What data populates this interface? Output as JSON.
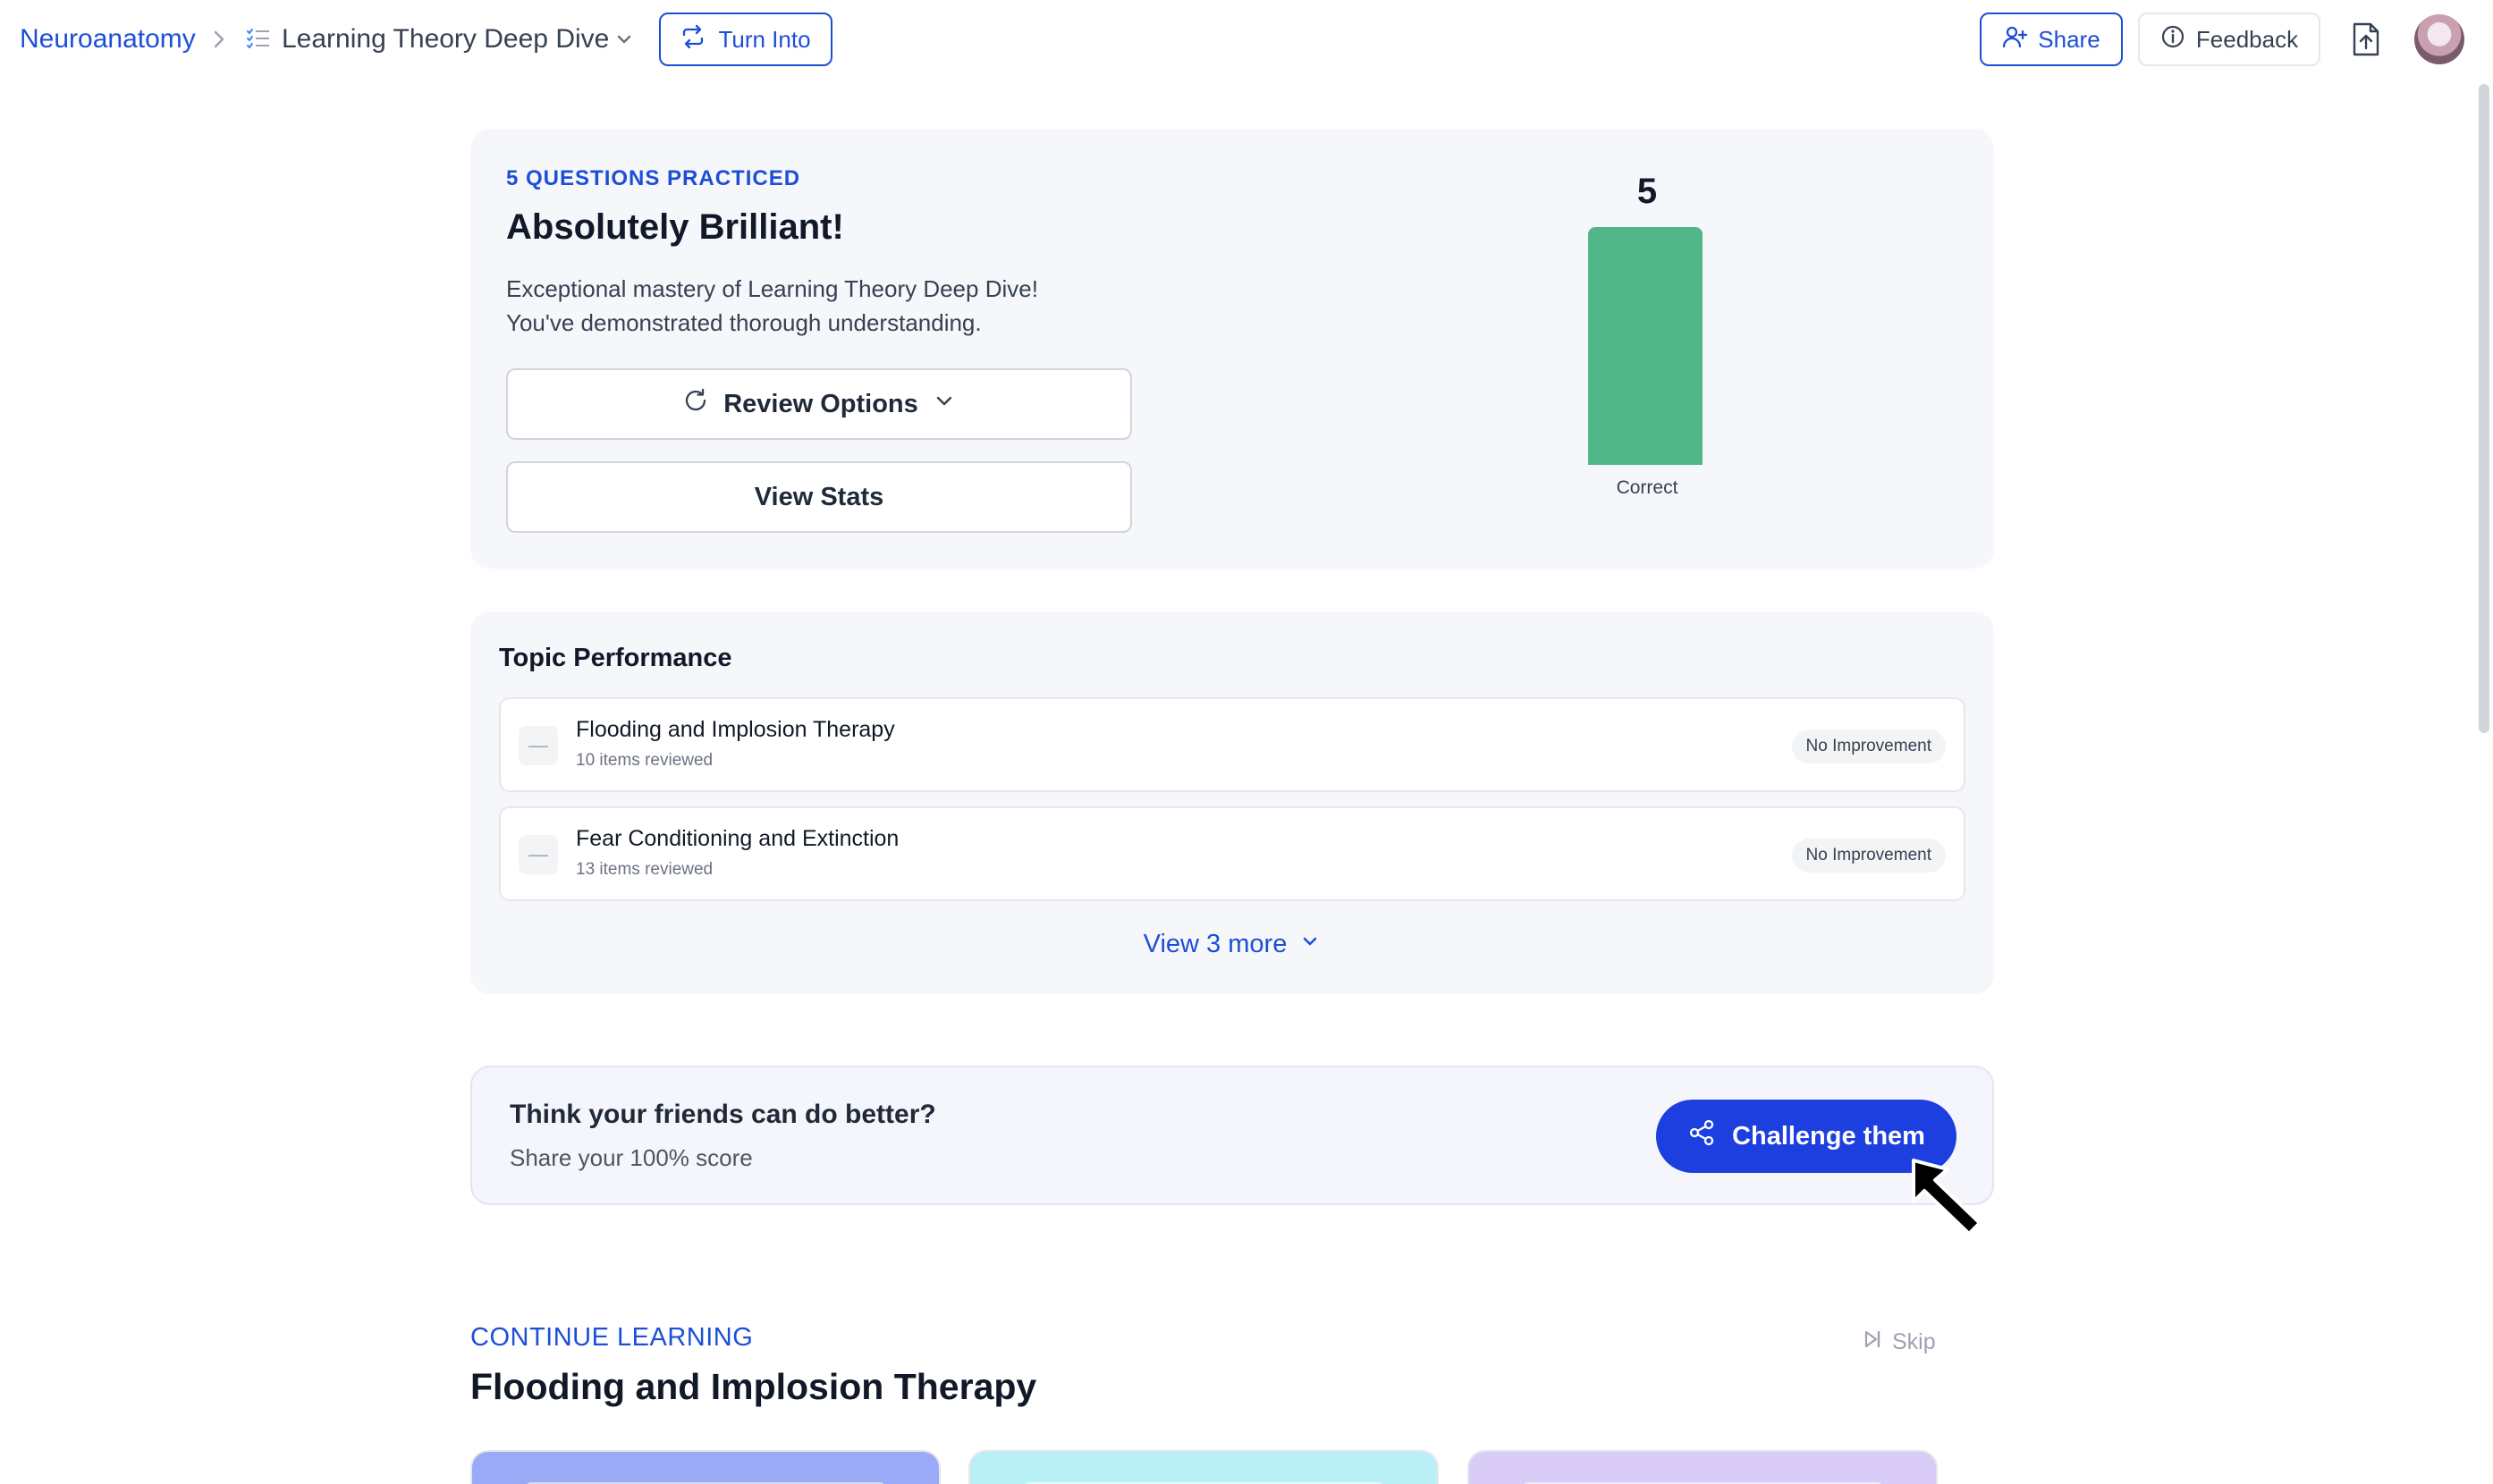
{
  "header": {
    "breadcrumb_root": "Neuroanatomy",
    "breadcrumb_doc": "Learning Theory Deep Dive",
    "turn_into_label": "Turn Into",
    "share_label": "Share",
    "feedback_label": "Feedback"
  },
  "score": {
    "eyebrow": "5 QUESTIONS PRACTICED",
    "title": "Absolutely Brilliant!",
    "description_line1": "Exceptional mastery of Learning Theory Deep Dive!",
    "description_line2": "You've demonstrated thorough understanding.",
    "review_options_label": "Review Options",
    "view_stats_label": "View Stats"
  },
  "chart_data": {
    "type": "bar",
    "categories": [
      "Correct"
    ],
    "values": [
      5
    ],
    "ylim": [
      0,
      5
    ],
    "colors": [
      "#52b788"
    ],
    "grid": false
  },
  "topics": {
    "title": "Topic Performance",
    "rows": [
      {
        "name": "Flooding and Implosion Therapy",
        "meta": "10 items reviewed",
        "badge": "No Improvement"
      },
      {
        "name": "Fear Conditioning and Extinction",
        "meta": "13 items reviewed",
        "badge": "No Improvement"
      }
    ],
    "view_more_label": "View 3 more"
  },
  "challenge": {
    "title": "Think your friends can do better?",
    "subtitle": "Share your 100% score",
    "button_label": "Challenge them"
  },
  "continue_learning": {
    "eyebrow": "CONTINUE LEARNING",
    "title": "Flooding and Implosion Therapy",
    "skip_label": "Skip"
  },
  "colors": {
    "accent": "#1d4ed8",
    "challenge_button": "#1d3fe0",
    "correct_bar": "#52b788",
    "card_bg": "#f5f7fb"
  },
  "icons": {
    "breadcrumb_separator": "chevron-right-icon",
    "doc": "checklist-icon",
    "turn_into": "repeat-icon",
    "share": "user-plus-icon",
    "feedback": "info-icon",
    "export": "file-upload-icon",
    "review": "refresh-icon",
    "challenge": "share-nodes-icon",
    "skip": "skip-forward-icon"
  }
}
